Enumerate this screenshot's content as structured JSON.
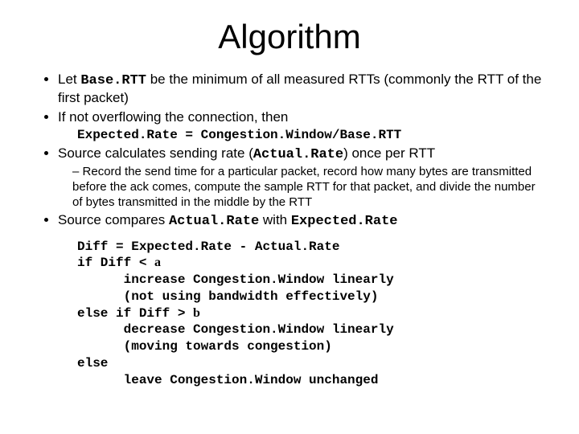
{
  "title": "Algorithm",
  "b1_a": "Let ",
  "b1_m": "Base.RTT",
  "b1_b": " be the minimum of all measured RTTs (commonly the RTT of the first packet)",
  "b2": "If not overflowing the connection, then",
  "formula": "Expected.Rate = Congestion.Window/Base.RTT",
  "b3_a": "Source calculates sending rate (",
  "b3_m": "Actual.Rate",
  "b3_b": ") once per RTT",
  "sub1": "Record the send time for a particular packet, record how many bytes are transmitted before the ack comes, compute the sample RTT for that packet, and divide the number of bytes transmitted in the middle by the RTT",
  "b4_a": "Source compares ",
  "b4_m1": "Actual.Rate",
  "b4_b": " with ",
  "b4_m2": "Expected.Rate",
  "code_l1": "Diff = Expected.Rate - Actual.Rate",
  "code_l2a": "if Diff < ",
  "alpha": "a",
  "code_l3": "      increase Congestion.Window linearly",
  "code_l4": "      (not using bandwidth effectively)",
  "code_l5a": "else if Diff > ",
  "beta": "b",
  "code_l6": "      decrease Congestion.Window linearly",
  "code_l7": "      (moving towards congestion)",
  "code_l8": "else",
  "code_l9": "      leave Congestion.Window unchanged"
}
